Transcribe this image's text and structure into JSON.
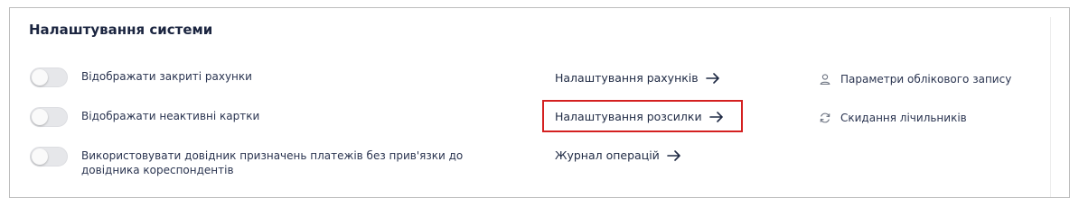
{
  "settings": {
    "title": "Налаштування системи",
    "toggles": [
      {
        "label": "Відображати закриті рахунки",
        "on": false
      },
      {
        "label": "Відображати неактивні картки",
        "on": false
      },
      {
        "label": "Використовувати довідник призначень платежів без прив'язки до довідника кореспондентів",
        "on": false
      }
    ],
    "links": [
      {
        "label": "Налаштування рахунків",
        "icon": "arrow-right-icon"
      },
      {
        "label": "Налаштування розсилки",
        "icon": "arrow-right-icon"
      },
      {
        "label": "Журнал операцій",
        "icon": "arrow-right-icon"
      }
    ],
    "side_links": [
      {
        "label": "Параметри облікового запису",
        "icon": "user-icon"
      },
      {
        "label": "Скидання лічильників",
        "icon": "refresh-icon"
      }
    ],
    "highlight_color": "#d42020"
  }
}
